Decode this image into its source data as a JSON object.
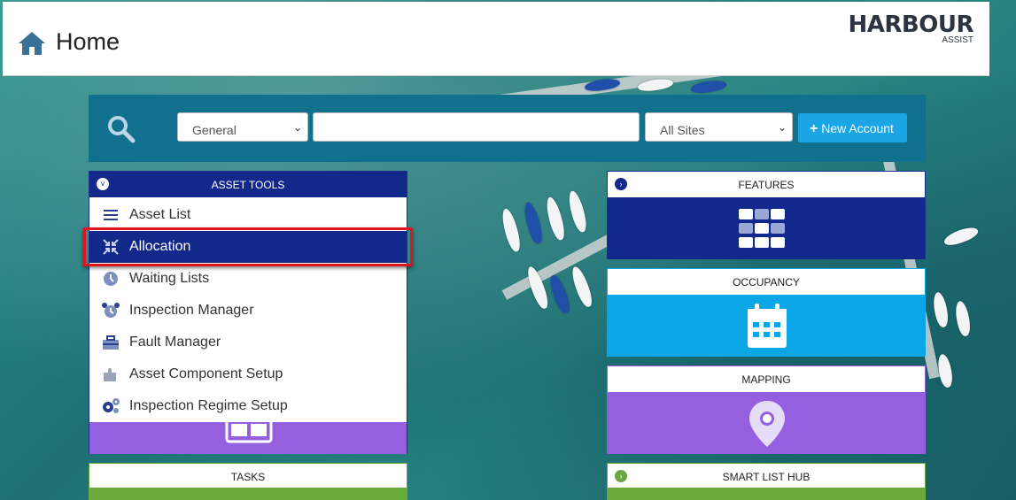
{
  "header": {
    "title": "Home",
    "logo_main": "HARBOUR",
    "logo_sub": "ASSIST"
  },
  "search": {
    "category_value": "General",
    "query": "",
    "site_value": "All Sites",
    "new_account_label": "New Account"
  },
  "asset_tools": {
    "title": "ASSET TOOLS",
    "items": [
      {
        "label": "Asset List",
        "icon": "list-icon"
      },
      {
        "label": "Allocation",
        "icon": "allocation-icon",
        "active": true
      },
      {
        "label": "Waiting Lists",
        "icon": "clock-icon"
      },
      {
        "label": "Inspection Manager",
        "icon": "alarm-clock-icon"
      },
      {
        "label": "Fault Manager",
        "icon": "toolbox-icon"
      },
      {
        "label": "Asset Component Setup",
        "icon": "puzzle-icon"
      },
      {
        "label": "Inspection Regime Setup",
        "icon": "gears-icon"
      }
    ]
  },
  "tiles": {
    "features": {
      "title": "FEATURES",
      "color": "#12288a"
    },
    "occupancy": {
      "title": "OCCUPANCY",
      "color": "#0aa6e6"
    },
    "mapping": {
      "title": "MAPPING",
      "color": "#9460df"
    },
    "tasks": {
      "title": "TASKS",
      "color": "#6aaa3a"
    },
    "smart_list_hub": {
      "title": "SMART LIST HUB",
      "color": "#6aaa3a"
    }
  },
  "colors": {
    "accent_blue": "#12288a",
    "search_bar": "#12708f",
    "button": "#1aa6e6",
    "highlight": "#e0141e"
  }
}
